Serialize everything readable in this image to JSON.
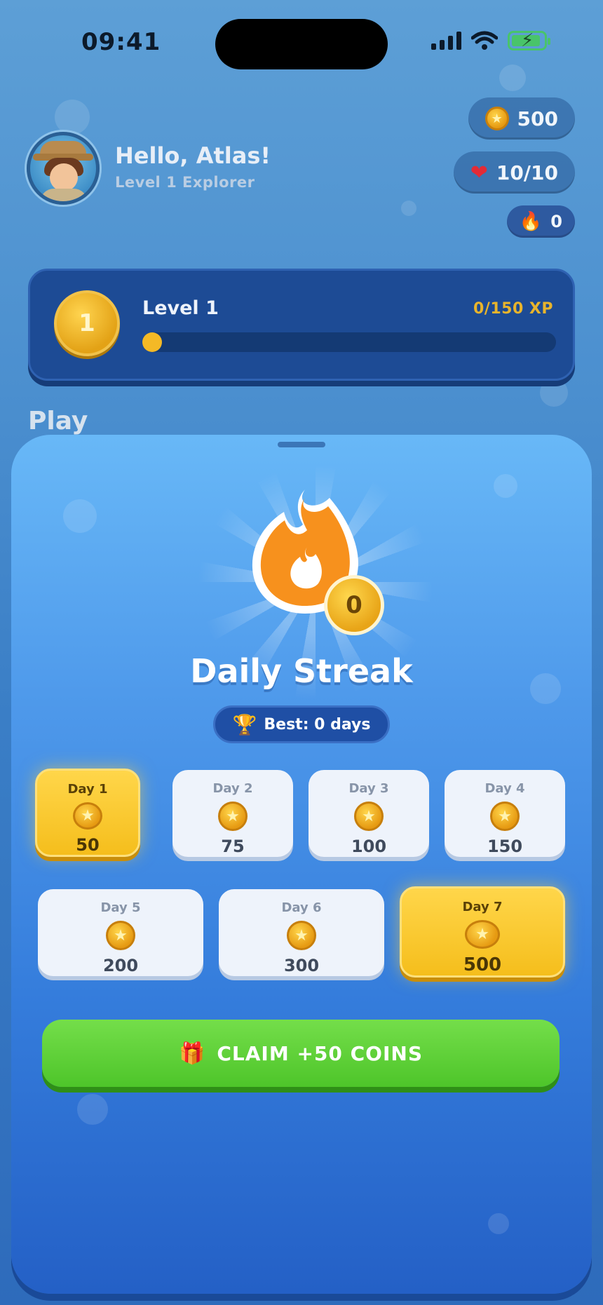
{
  "status": {
    "time": "09:41"
  },
  "header": {
    "greeting": "Hello, Atlas!",
    "subtitle": "Level 1 Explorer",
    "coins": "500",
    "hearts": "10/10",
    "streak_count": "0"
  },
  "level": {
    "badge": "1",
    "title": "Level 1",
    "xp_text": "0/150 XP",
    "xp_progress": 0.0
  },
  "section": {
    "play_label": "Play"
  },
  "streak": {
    "current": "0",
    "title": "Daily Streak",
    "best_label": "Best: 0 days",
    "days": [
      {
        "label": "Day 1",
        "reward": "50",
        "highlight": true
      },
      {
        "label": "Day 2",
        "reward": "75",
        "highlight": false
      },
      {
        "label": "Day 3",
        "reward": "100",
        "highlight": false
      },
      {
        "label": "Day 4",
        "reward": "150",
        "highlight": false
      },
      {
        "label": "Day 5",
        "reward": "200",
        "highlight": false
      },
      {
        "label": "Day 6",
        "reward": "300",
        "highlight": false
      },
      {
        "label": "Day 7",
        "reward": "500",
        "highlight": true
      }
    ],
    "claim_label": "CLAIM +50 COINS"
  },
  "colors": {
    "accent_gold": "#f5be1c",
    "claim_green": "#4ec52a",
    "card_navy": "#1d4b95",
    "heart_red": "#e32b36"
  },
  "icons": [
    "coin-icon",
    "heart-icon",
    "flame-icon",
    "trophy-icon",
    "gift-icon",
    "signal-icon",
    "wifi-icon",
    "battery-icon"
  ]
}
